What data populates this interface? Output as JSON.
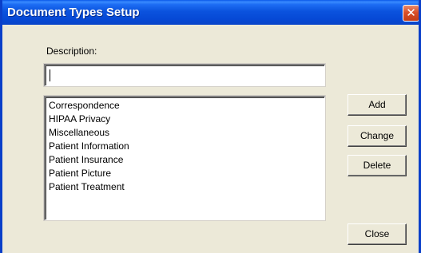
{
  "window": {
    "title": "Document Types Setup",
    "close_glyph": "✕"
  },
  "form": {
    "description_label": "Description:",
    "description_value": ""
  },
  "document_types": [
    "Correspondence",
    "HIPAA Privacy",
    "Miscellaneous",
    "Patient Information",
    "Patient Insurance",
    "Patient Picture",
    "Patient Treatment"
  ],
  "buttons": {
    "add": "Add",
    "change": "Change",
    "delete": "Delete",
    "close": "Close"
  },
  "colors": {
    "titlebar": "#0b53de",
    "window_face": "#ece9d8",
    "close_button": "#d9502a"
  }
}
